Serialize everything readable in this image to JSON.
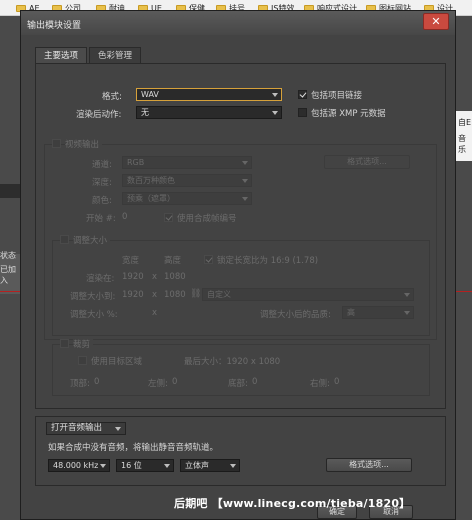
{
  "bookmarks": [
    {
      "label": "AE"
    },
    {
      "label": "公司"
    },
    {
      "label": "耐迪"
    },
    {
      "label": "UE"
    },
    {
      "label": "保健"
    },
    {
      "label": "挂号"
    },
    {
      "label": "JS特效"
    },
    {
      "label": "响应式设计"
    },
    {
      "label": "图标网站"
    },
    {
      "label": "设计"
    }
  ],
  "background": {
    "left_text_1": "状态",
    "left_text_2": "已加入",
    "right_text_1": "自E",
    "right_text_2": "音乐"
  },
  "dialog": {
    "title": "输出模块设置",
    "close_glyph": "✕",
    "tabs": [
      {
        "label": "主要选项"
      },
      {
        "label": "色彩管理"
      }
    ],
    "format_label": "格式:",
    "format_value": "WAV",
    "post_render_label": "渲染后动作:",
    "post_render_value": "无",
    "include_project_link": "包括项目链接",
    "include_xmp": "包括源 XMP 元数据",
    "video": {
      "header": "视频输出",
      "channels_label": "通道:",
      "channels_value": "RGB",
      "depth_label": "深度:",
      "depth_value": "数百万种颜色",
      "color_label": "颜色:",
      "color_value": "预乘（遮罩）",
      "start_label": "开始 #:",
      "start_value": "0",
      "use_comp_frame": "使用合成帧编号",
      "format_options": "格式选项...",
      "resize": {
        "header": "调整大小",
        "width_label": "宽度",
        "height_label": "高度",
        "lock_aspect": "锁定长宽比为 16:9 (1.78)",
        "render_at_label": "渲染在:",
        "render_w": "1920",
        "x1": "x",
        "render_h": "1080",
        "resize_to_label": "调整大小到:",
        "resize_w": "1920",
        "x2": "x",
        "resize_h": "1080",
        "preset_value": "自定义",
        "percent_label": "调整大小 %:",
        "x3": "x",
        "quality_label": "调整大小后的品质:",
        "quality_value": "高"
      },
      "crop": {
        "header": "裁剪",
        "use_roi": "使用目标区域",
        "max_size": "最后大小：1920 x 1080",
        "top_label": "顶部:",
        "top_value": "0",
        "left_label": "左侧:",
        "left_value": "0",
        "bottom_label": "底部:",
        "bottom_value": "0",
        "right_label": "右侧:",
        "right_value": "0"
      }
    },
    "audio": {
      "mode_value": "打开音频输出",
      "note": "如果合成中没有音频，将输出静音音频轨道。",
      "rate_value": "48.000 kHz",
      "bits_value": "16 位",
      "channels_value": "立体声",
      "format_options": "格式选项..."
    },
    "ok_label": "确定",
    "cancel_label": "取消"
  },
  "watermark": "后期吧 【www.linecg.com/tieba/1820】"
}
